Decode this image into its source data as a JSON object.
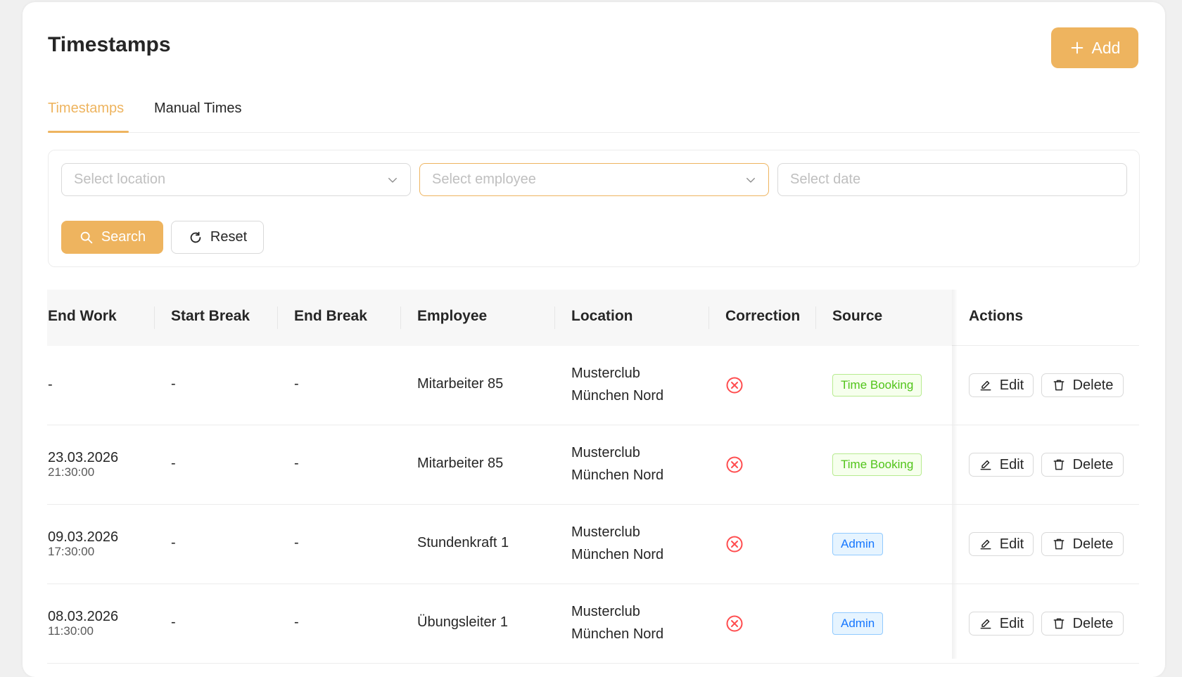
{
  "header": {
    "title": "Timestamps",
    "add_label": "Add"
  },
  "tabs": [
    {
      "label": "Timestamps",
      "active": true
    },
    {
      "label": "Manual Times",
      "active": false
    }
  ],
  "filters": {
    "location_placeholder": "Select location",
    "employee_placeholder": "Select employee",
    "date_placeholder": "Select date",
    "search_label": "Search",
    "reset_label": "Reset"
  },
  "table": {
    "columns": [
      "End Work",
      "Start Break",
      "End Break",
      "Employee",
      "Location",
      "Correction",
      "Source",
      "Actions"
    ],
    "rows": [
      {
        "end_work_date": "-",
        "end_work_time": "",
        "start_break": "-",
        "end_break": "-",
        "employee": "Mitarbeiter 85",
        "location_line1": "Musterclub",
        "location_line2": "München Nord",
        "correction": "no",
        "source": "Time Booking",
        "source_color": "green"
      },
      {
        "end_work_date": "23.03.2026",
        "end_work_time": "21:30:00",
        "start_break": "-",
        "end_break": "-",
        "employee": "Mitarbeiter 85",
        "location_line1": "Musterclub",
        "location_line2": "München Nord",
        "correction": "no",
        "source": "Time Booking",
        "source_color": "green"
      },
      {
        "end_work_date": "09.03.2026",
        "end_work_time": "17:30:00",
        "start_break": "-",
        "end_break": "-",
        "employee": "Stundenkraft 1",
        "location_line1": "Musterclub",
        "location_line2": "München Nord",
        "correction": "no",
        "source": "Admin",
        "source_color": "blue"
      },
      {
        "end_work_date": "08.03.2026",
        "end_work_time": "11:30:00",
        "start_break": "-",
        "end_break": "-",
        "employee": "Übungsleiter 1",
        "location_line1": "Musterclub",
        "location_line2": "München Nord",
        "correction": "no",
        "source": "Admin",
        "source_color": "blue"
      }
    ],
    "edit_label": "Edit",
    "delete_label": "Delete"
  },
  "colors": {
    "accent": "#eeb45f",
    "danger": "#ff4d4f"
  }
}
